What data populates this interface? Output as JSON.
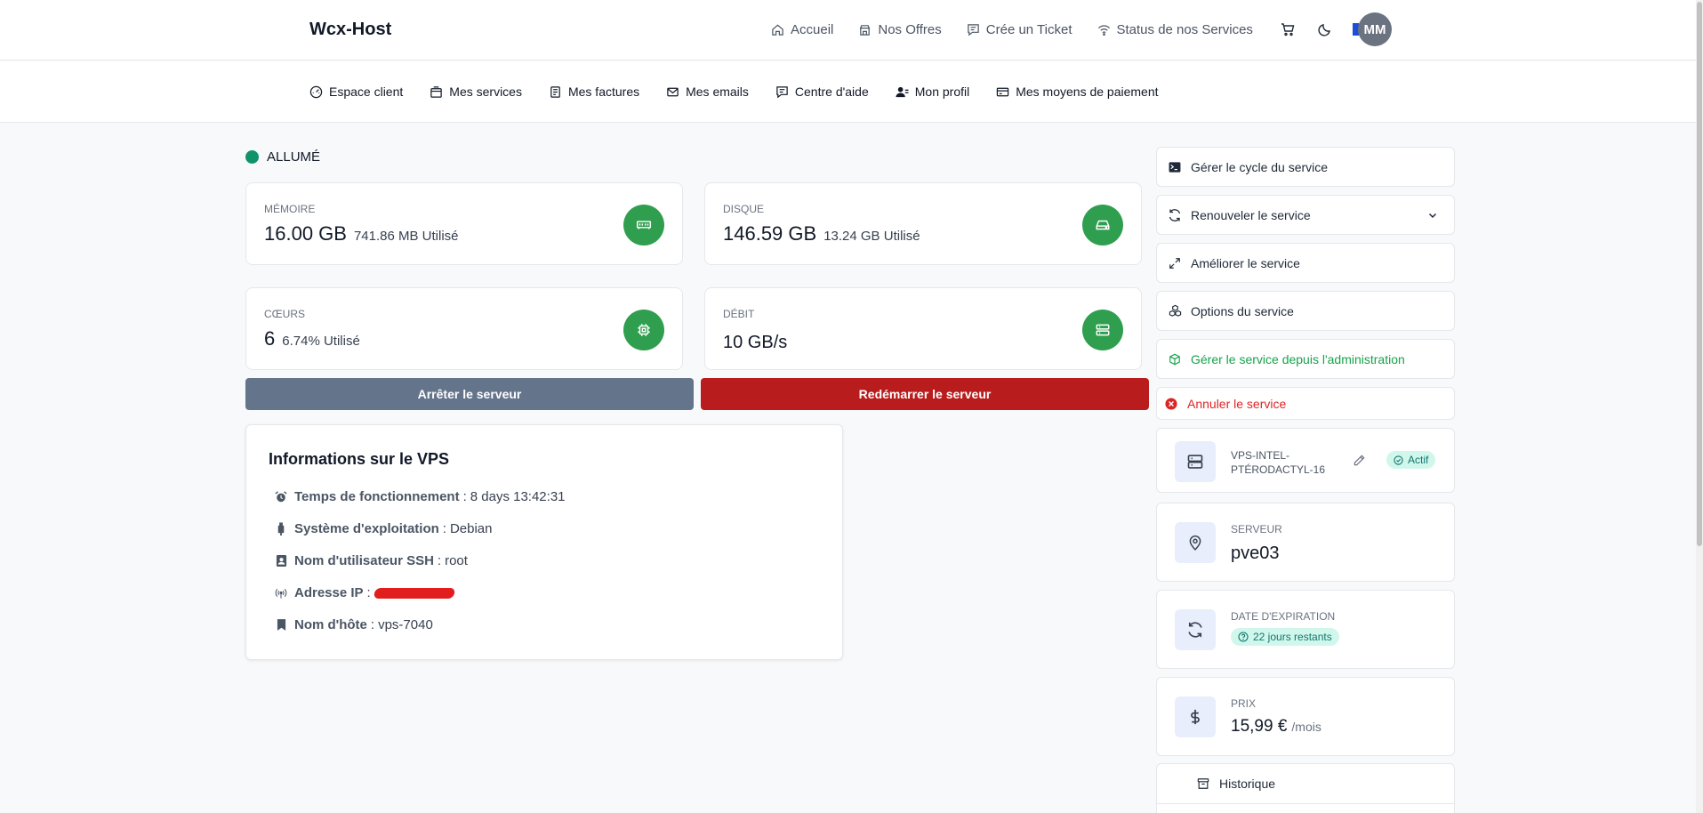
{
  "brand": "Wcx-Host",
  "topnav": {
    "items": [
      {
        "label": "Accueil",
        "icon": "home-icon"
      },
      {
        "label": "Nos Offres",
        "icon": "store-icon"
      },
      {
        "label": "Crée un Ticket",
        "icon": "message-icon"
      },
      {
        "label": "Status de nos Services",
        "icon": "wifi-icon"
      }
    ],
    "avatar": "MM"
  },
  "subnav": {
    "items": [
      {
        "label": "Espace client",
        "icon": "dashboard-icon"
      },
      {
        "label": "Mes services",
        "icon": "box-icon"
      },
      {
        "label": "Mes factures",
        "icon": "invoice-icon"
      },
      {
        "label": "Mes emails",
        "icon": "mail-icon"
      },
      {
        "label": "Centre d'aide",
        "icon": "help-icon"
      },
      {
        "label": "Mon profil",
        "icon": "user-icon"
      },
      {
        "label": "Mes moyens de paiement",
        "icon": "card-icon"
      }
    ]
  },
  "status": "ALLUMÉ",
  "stats": {
    "memory": {
      "label": "MÉMOIRE",
      "value": "16.00 GB",
      "used": "741.86 MB Utilisé"
    },
    "disk": {
      "label": "DISQUE",
      "value": "146.59 GB",
      "used": "13.24 GB Utilisé"
    },
    "cores": {
      "label": "CŒURS",
      "value": "6",
      "used": "6.74% Utilisé"
    },
    "bandwidth": {
      "label": "DÉBIT",
      "value": "10 GB/s"
    }
  },
  "actions": {
    "stop": "Arrêter le serveur",
    "restart": "Redémarrer le serveur"
  },
  "vps_info": {
    "title": "Informations sur le VPS",
    "rows": [
      {
        "label": "Temps de fonctionnement",
        "value": "8 days 13:42:31"
      },
      {
        "label": "Système d'exploitation",
        "value": "Debian"
      },
      {
        "label": "Nom d'utilisateur SSH",
        "value": "root"
      },
      {
        "label": "Adresse IP",
        "value": ""
      },
      {
        "label": "Nom d'hôte",
        "value": "vps-7040"
      }
    ]
  },
  "sidebar": {
    "buttons": [
      "Gérer le cycle du service",
      "Renouveler le service",
      "Améliorer le service",
      "Options du service",
      "Gérer le service depuis l'administration",
      "Annuler le service"
    ],
    "product": {
      "name": "VPS-INTEL-PTÉRODACTYL-16",
      "status": "Actif"
    },
    "server": {
      "label": "SERVEUR",
      "value": "pve03"
    },
    "expiration": {
      "label": "DATE D'EXPIRATION",
      "value": "22 jours restants"
    },
    "price": {
      "label": "PRIX",
      "value": "15,99 €",
      "period": "/mois"
    },
    "history": "Historique"
  },
  "colors": {
    "status_on": "#10936b",
    "stat_icon": "#2f9e4f",
    "stop_button": "#64748b",
    "restart_button": "#b91c1c",
    "admin_link": "#16a34a",
    "cancel_link": "#dc2626"
  }
}
